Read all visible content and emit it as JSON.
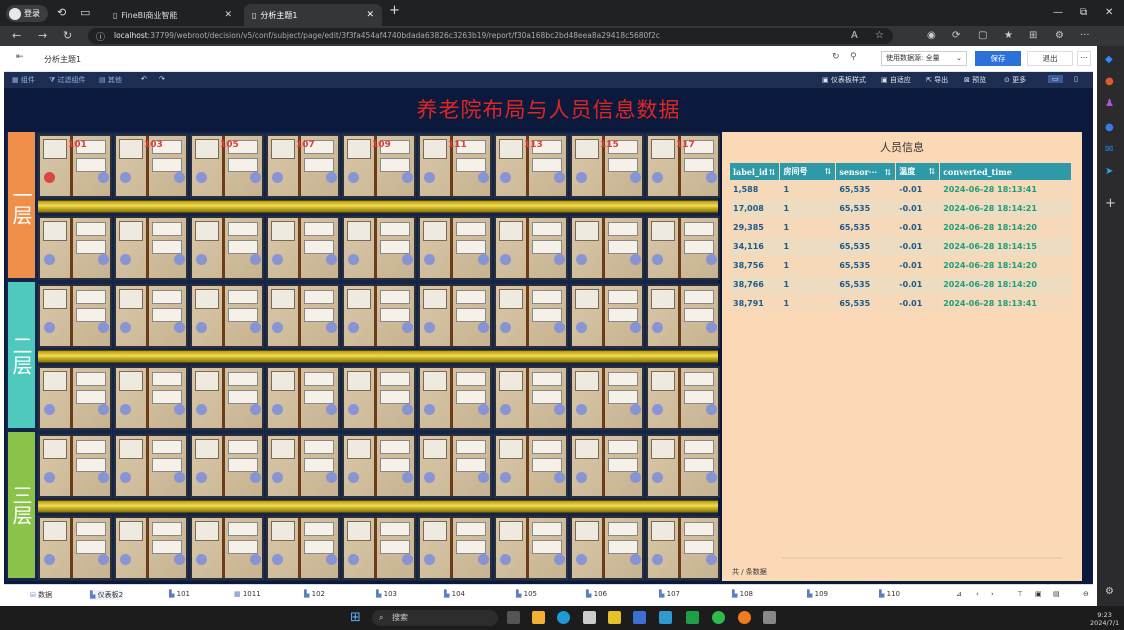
{
  "browser": {
    "login": "登录",
    "tabs": [
      {
        "label": "FineBI商业智能"
      },
      {
        "label": "分析主题1"
      }
    ],
    "url_host": "localhost",
    "url_rest": ":37799/webroot/decision/v5/conf/subject/page/edit/3f3fa454af4740bdada63826c3263b19/report/f30a168bc2bd48eea8a29418c5680f2c"
  },
  "fr": {
    "title": "分析主题1",
    "data_select": "使用数据源: 全量",
    "save": "保存",
    "exit": "退出",
    "more": "···",
    "sub_left": [
      "组件",
      "过滤组件",
      "其他"
    ],
    "sub_right": [
      "仪表板样式",
      "自适应",
      "导出",
      "预览",
      "更多"
    ]
  },
  "canvas": {
    "title": "养老院布局与人员信息数据",
    "floors": [
      "一层",
      "二层",
      "三层"
    ],
    "floor_colors": [
      "#ef8f4a",
      "#4ec9be",
      "#8bc34a"
    ],
    "room_numbers": [
      "101",
      "103",
      "105",
      "107",
      "109",
      "111",
      "113",
      "115",
      "117"
    ]
  },
  "info": {
    "title": "人员信息",
    "columns": [
      "label_id",
      "房间号",
      "sensor···",
      "温度",
      "converted_time"
    ],
    "rows": [
      [
        "1,588",
        "1",
        "65,535",
        "-0.01",
        "2024-06-28 18:13:41"
      ],
      [
        "17,008",
        "1",
        "65,535",
        "-0.01",
        "2024-06-28 18:14:21"
      ],
      [
        "29,385",
        "1",
        "65,535",
        "-0.01",
        "2024-06-28 18:14:20"
      ],
      [
        "34,116",
        "1",
        "65,535",
        "-0.01",
        "2024-06-28 18:14:15"
      ],
      [
        "38,756",
        "1",
        "65,535",
        "-0.01",
        "2024-06-28 18:14:20"
      ],
      [
        "38,766",
        "1",
        "65,535",
        "-0.01",
        "2024-06-28 18:14:20"
      ],
      [
        "38,791",
        "1",
        "65,535",
        "-0.01",
        "2024-06-28 18:13:41"
      ]
    ],
    "footer": "共 / 条数据"
  },
  "bottom_tabs": [
    "数据",
    "仪表板2",
    "101",
    "1011",
    "102",
    "103",
    "104",
    "105",
    "106",
    "107",
    "108",
    "109",
    "110"
  ],
  "taskbar": {
    "search": "搜索",
    "time": "9:23",
    "date": "2024/7/1"
  }
}
